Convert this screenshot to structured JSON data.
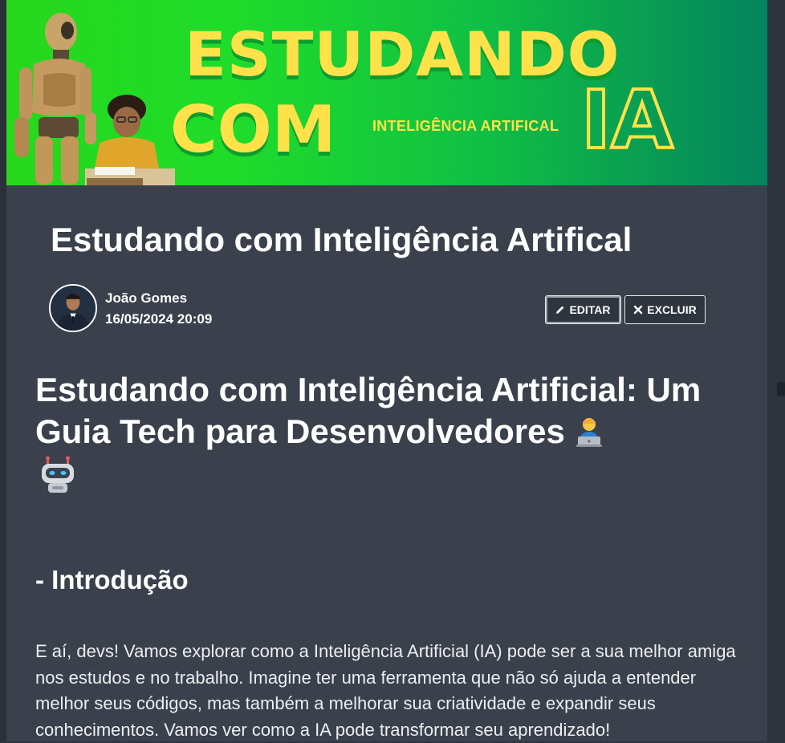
{
  "banner": {
    "line1": "ESTUDANDO",
    "line2": "COM",
    "subtitle": "INTELIGÊNCIA ARTIFICAL",
    "big": "IA"
  },
  "post": {
    "title": "Estudando com Inteligência Artifical",
    "author_name": "João Gomes",
    "date": "16/05/2024 20:09"
  },
  "actions": {
    "edit_label": "EDITAR",
    "delete_label": "EXCLUIR"
  },
  "content": {
    "h1_text": "Estudando com Inteligência Artificial: Um Guia Tech para Desenvolvedores",
    "h2": "- Introdução",
    "paragraph": "E aí, devs! Vamos explorar como a Inteligência Artificial (IA) pode ser a sua melhor amiga nos estudos e no trabalho. Imagine ter uma ferramenta que não só ajuda a entender melhor seus códigos, mas também a melhorar sua criatividade e expandir seus conhecimentos. Vamos ver como a IA pode transformar seu aprendizado!"
  },
  "icons": {
    "edit": "pencil-icon",
    "delete": "x-icon",
    "emoji1": "technologist-emoji-icon",
    "emoji2": "robot-emoji-icon"
  },
  "colors": {
    "banner_yellow": "#ffe24a",
    "article_bg": "#3a414c"
  }
}
